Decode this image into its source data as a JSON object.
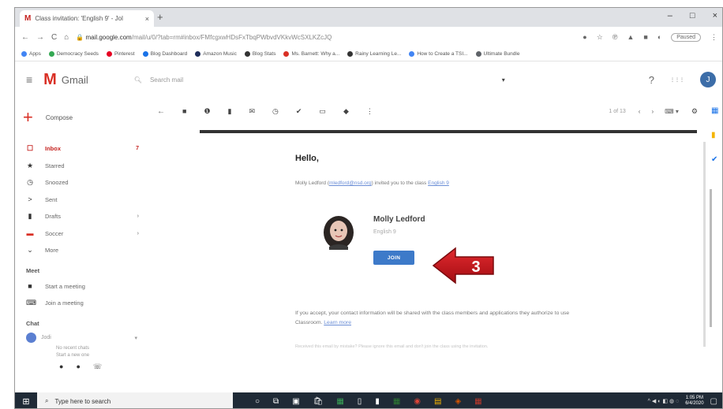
{
  "browser": {
    "tab_icon": "M",
    "tab_title": "Class invitation: 'English 9' - Jol",
    "tab_close": "×",
    "new_tab": "+",
    "window_controls": [
      "–",
      "□",
      "×"
    ],
    "nav": [
      "←",
      "→",
      "C",
      "⌂"
    ],
    "url_host": "mail.google.com",
    "url_rest": "/mail/u/0/?tab=rm#inbox/FMfcgxwHDsFxTbqPWbvdVKkvWcSXLKZcJQ",
    "paused_label": "Paused",
    "bookmarks": [
      {
        "label": "Apps",
        "color": "#4285f4"
      },
      {
        "label": "Democracy Seeds",
        "color": "#34a853"
      },
      {
        "label": "Pinterest",
        "color": "#e60023"
      },
      {
        "label": "Blog Dashboard",
        "color": "#1a73e8"
      },
      {
        "label": "Amazon Music",
        "color": "#1e2d5a"
      },
      {
        "label": "Blog Stats",
        "color": "#333333"
      },
      {
        "label": "Ms. Barnett: Why a...",
        "color": "#d93025"
      },
      {
        "label": "Rainy Learning Le...",
        "color": "#333333"
      },
      {
        "label": "How to Create a TSI...",
        "color": "#4285f4"
      },
      {
        "label": "Ultimate Bundle",
        "color": "#5f6368"
      }
    ]
  },
  "gmail": {
    "menu_icon": "≡",
    "logo_m": "M",
    "logo_text": "Gmail",
    "search_placeholder": "Search mail",
    "search_caret": "▾",
    "support_icon": "?",
    "apps_icon": "⋮⋮⋮",
    "avatar_letter": "J",
    "compose_label": "Compose",
    "nav_items": [
      {
        "label": "Inbox",
        "count": "7",
        "icon": "inbox-icon",
        "glyph": "☐"
      },
      {
        "label": "Starred",
        "count": "",
        "icon": "star-icon",
        "glyph": "★"
      },
      {
        "label": "Snoozed",
        "count": "",
        "icon": "clock-icon",
        "glyph": "◷"
      },
      {
        "label": "Sent",
        "count": "",
        "icon": "send-icon",
        "glyph": ">"
      },
      {
        "label": "Drafts",
        "count": "›",
        "icon": "file-icon",
        "glyph": "▮"
      },
      {
        "label": "Soccer",
        "count": "›",
        "icon": "label-icon",
        "glyph": "▬"
      },
      {
        "label": "More",
        "count": "",
        "icon": "chevron-down-icon",
        "glyph": "⌄"
      }
    ],
    "meet_heading": "Meet",
    "meet_items": [
      {
        "label": "Start a meeting",
        "glyph": "■"
      },
      {
        "label": "Join a meeting",
        "glyph": "⌨"
      }
    ],
    "chat_heading": "Chat",
    "chat_user": "Jodi",
    "chat_caret": "▾",
    "chat_note_1": "No recent chats",
    "chat_note_2": "Start a new one",
    "chat_icons": [
      "●",
      "●",
      "☏"
    ],
    "toolbar": {
      "back": "←",
      "icons": [
        "■",
        "❶",
        "▮",
        "✉",
        "◷",
        "✔",
        "▭",
        "◆",
        "⋮"
      ],
      "pager": "1 of 13",
      "prev": "‹",
      "next": "›",
      "keyboard": "⌨ ▾",
      "settings": "⚙"
    }
  },
  "message": {
    "greeting": "Hello,",
    "invite_prefix": "Molly Ledford (",
    "invite_email": "mledford@nsd.org",
    "invite_mid": ") invited you to the class ",
    "invite_class": "English 9",
    "teacher_name": "Molly Ledford",
    "class_name": "English 9",
    "join_label": "JOIN",
    "step_number": "3",
    "fine_print": "If you accept, your contact information will be shared with the class members and applications they authorize to use Classroom.",
    "learn_more": "Learn more",
    "footer_note": "Received this email by mistake? Please ignore this email and don't join the class using the invitation."
  },
  "taskbar": {
    "start_glyph": "⊞",
    "search_glyph": "⌕",
    "search_placeholder": "Type here to search",
    "app_glyphs": [
      "○",
      "⧉",
      "▣",
      "🛍",
      "▦",
      "▯",
      "▮",
      "▦",
      "◉",
      "▤",
      "◈",
      "▦"
    ],
    "tray_glyphs": "^ ◀ ◐ ◧ ◍ ◌",
    "time": "1:05 PM",
    "date": "6/4/2020",
    "notify_glyph": "▢"
  },
  "colors": {
    "gmail_red": "#d93025",
    "join_blue": "#3d7ac9",
    "arrow_red": "#c8151b",
    "taskbar": "#1f2a36"
  }
}
